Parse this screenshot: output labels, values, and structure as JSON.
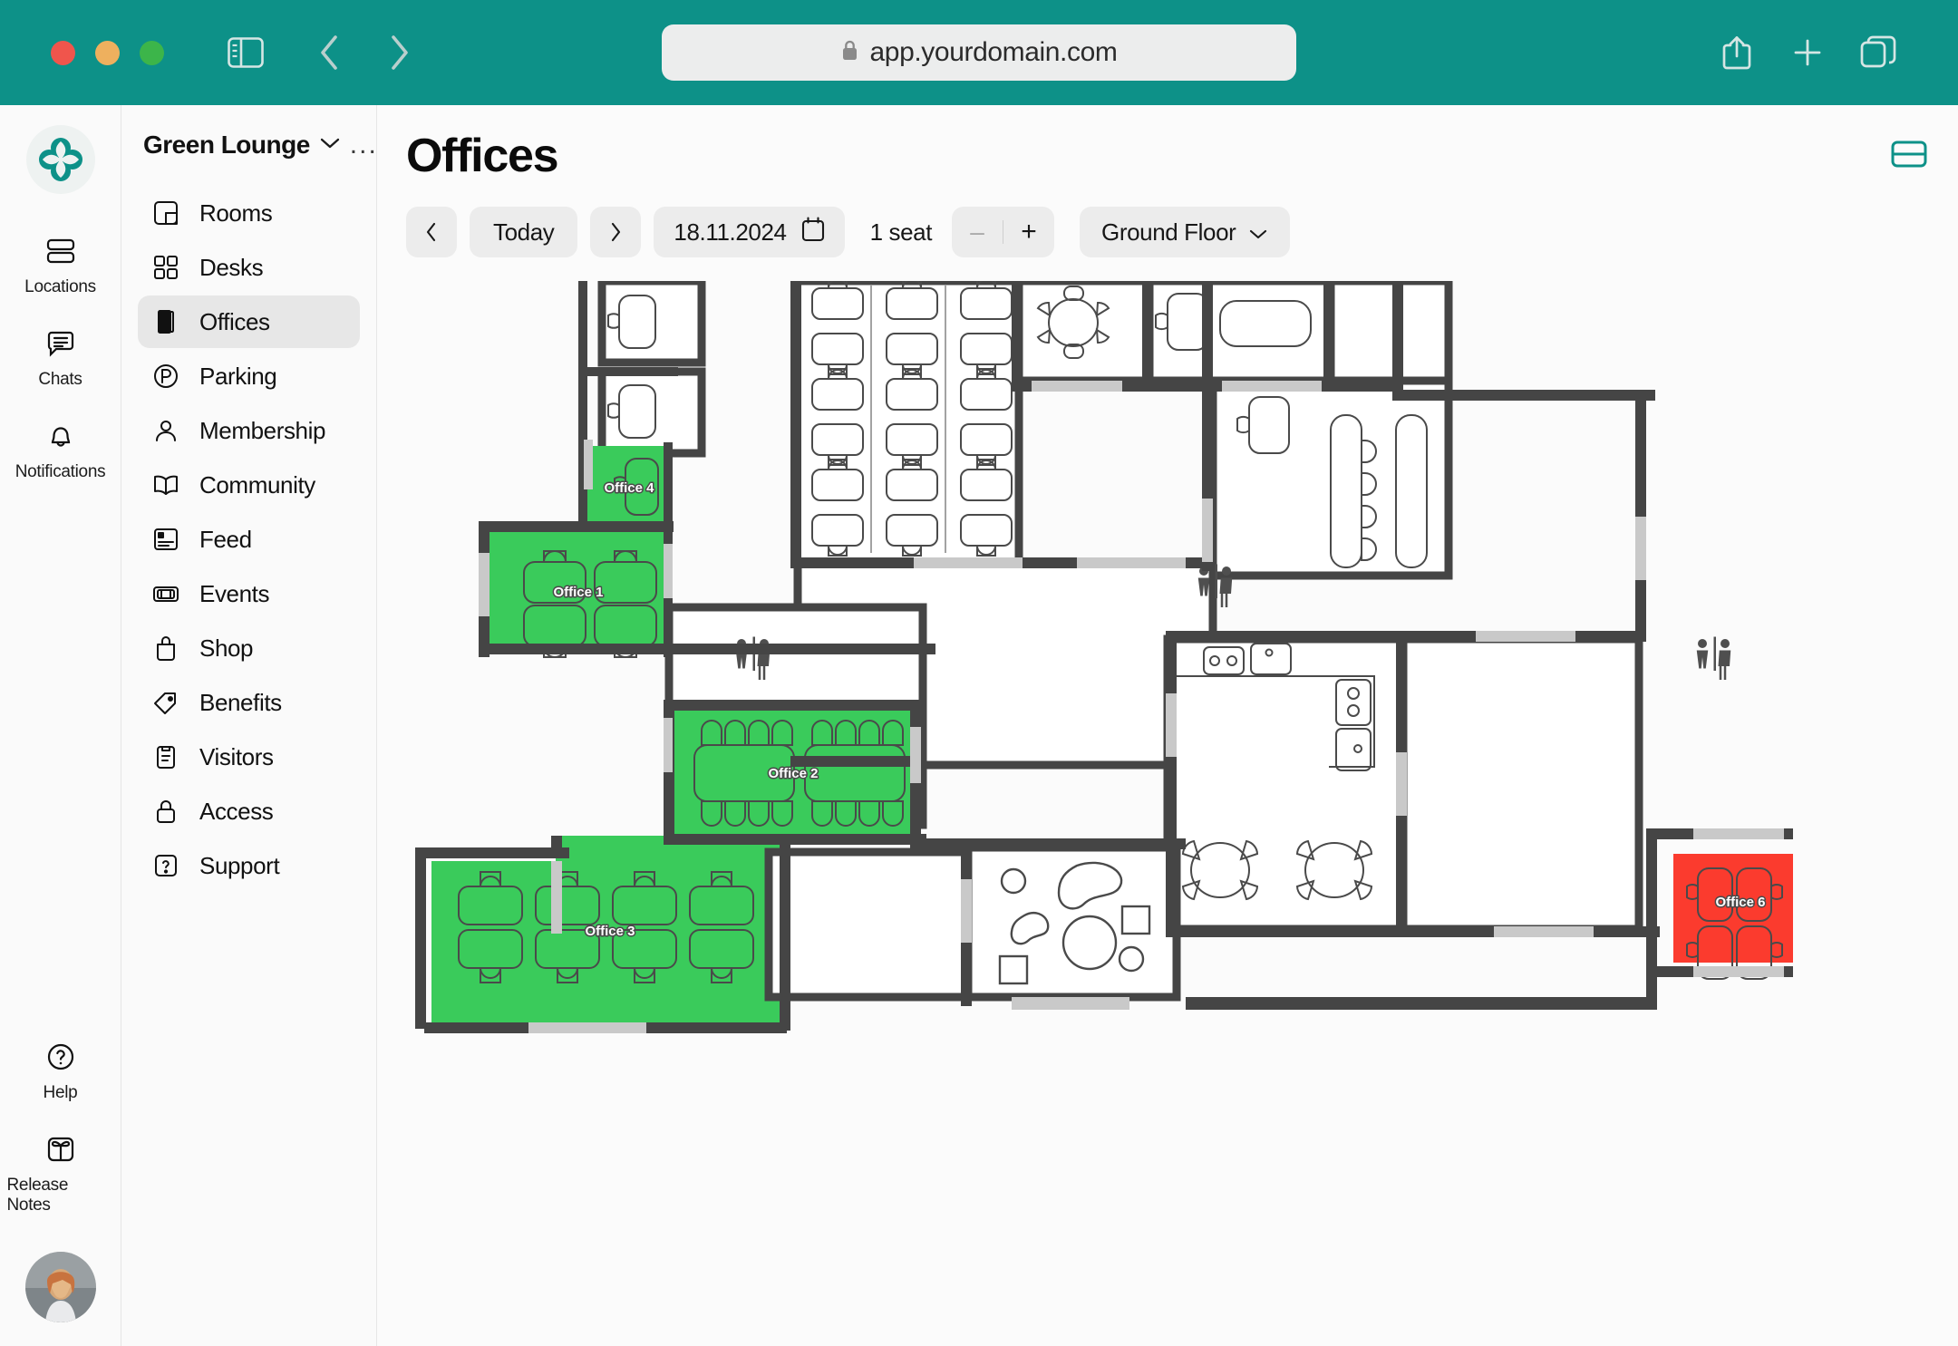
{
  "browser": {
    "url": "app.yourdomain.com",
    "lock_icon": "lock-icon",
    "traffic_lights": [
      "close",
      "minimize",
      "maximize"
    ],
    "buttons": {
      "sidebar_toggle": "sidebar-toggle-icon",
      "back": "back-chevron-icon",
      "forward": "forward-chevron-icon",
      "share": "share-icon",
      "new_tab": "plus-icon",
      "tabs_overview": "tabs-icon"
    }
  },
  "rail": {
    "logo": "clover-logo",
    "items": [
      {
        "label": "Locations",
        "icon": "locations-icon"
      },
      {
        "label": "Chats",
        "icon": "chat-icon"
      },
      {
        "label": "Notifications",
        "icon": "bell-icon"
      }
    ],
    "bottom_items": [
      {
        "label": "Help",
        "icon": "question-circle-icon"
      },
      {
        "label": "Release Notes",
        "icon": "gift-icon"
      }
    ],
    "avatar": "user-avatar"
  },
  "sidebar": {
    "location_name": "Green Lounge",
    "location_chevron": "chevron-down-icon",
    "more_menu": "...",
    "items": [
      {
        "label": "Rooms",
        "icon": "rooms-icon",
        "active": false
      },
      {
        "label": "Desks",
        "icon": "desks-icon",
        "active": false
      },
      {
        "label": "Offices",
        "icon": "offices-icon",
        "active": true
      },
      {
        "label": "Parking",
        "icon": "parking-icon",
        "active": false
      },
      {
        "label": "Membership",
        "icon": "person-icon",
        "active": false
      },
      {
        "label": "Community",
        "icon": "book-icon",
        "active": false
      },
      {
        "label": "Feed",
        "icon": "feed-icon",
        "active": false
      },
      {
        "label": "Events",
        "icon": "ticket-icon",
        "active": false
      },
      {
        "label": "Shop",
        "icon": "bag-icon",
        "active": false
      },
      {
        "label": "Benefits",
        "icon": "tag-icon",
        "active": false
      },
      {
        "label": "Visitors",
        "icon": "clipboard-icon",
        "active": false
      },
      {
        "label": "Access",
        "icon": "lock-icon",
        "active": false
      },
      {
        "label": "Support",
        "icon": "support-icon",
        "active": false
      }
    ]
  },
  "main": {
    "title": "Offices",
    "view_toggle_icon": "list-view-icon",
    "toolbar": {
      "prev_label": "‹",
      "today_label": "Today",
      "next_label": "›",
      "date_value": "18.11.2024",
      "calendar_icon": "calendar-icon",
      "seat_label": "1 seat",
      "decrement_label": "–",
      "increment_label": "+",
      "floor_label": "Ground Floor",
      "floor_chevron": "chevron-down-icon"
    }
  },
  "floorplan": {
    "colors": {
      "available": "#3ACB5B",
      "unavailable": "#FB3B2E",
      "wall": "#454545",
      "door": "#C9C9C9",
      "furniture_stroke": "#4a4a4a",
      "floor": "#FFFFFF"
    },
    "offices": [
      {
        "name": "Office 1",
        "status": "available"
      },
      {
        "name": "Office 2",
        "status": "available"
      },
      {
        "name": "Office 3",
        "status": "available"
      },
      {
        "name": "Office 4",
        "status": "available"
      },
      {
        "name": "Office 6",
        "status": "unavailable"
      }
    ],
    "amenities": [
      {
        "name": "restroom",
        "count": 3
      },
      {
        "name": "kitchen",
        "count": 1
      },
      {
        "name": "lounge",
        "count": 1
      },
      {
        "name": "open-desk-area",
        "count": 1
      },
      {
        "name": "meeting-room",
        "count": 2
      }
    ]
  }
}
